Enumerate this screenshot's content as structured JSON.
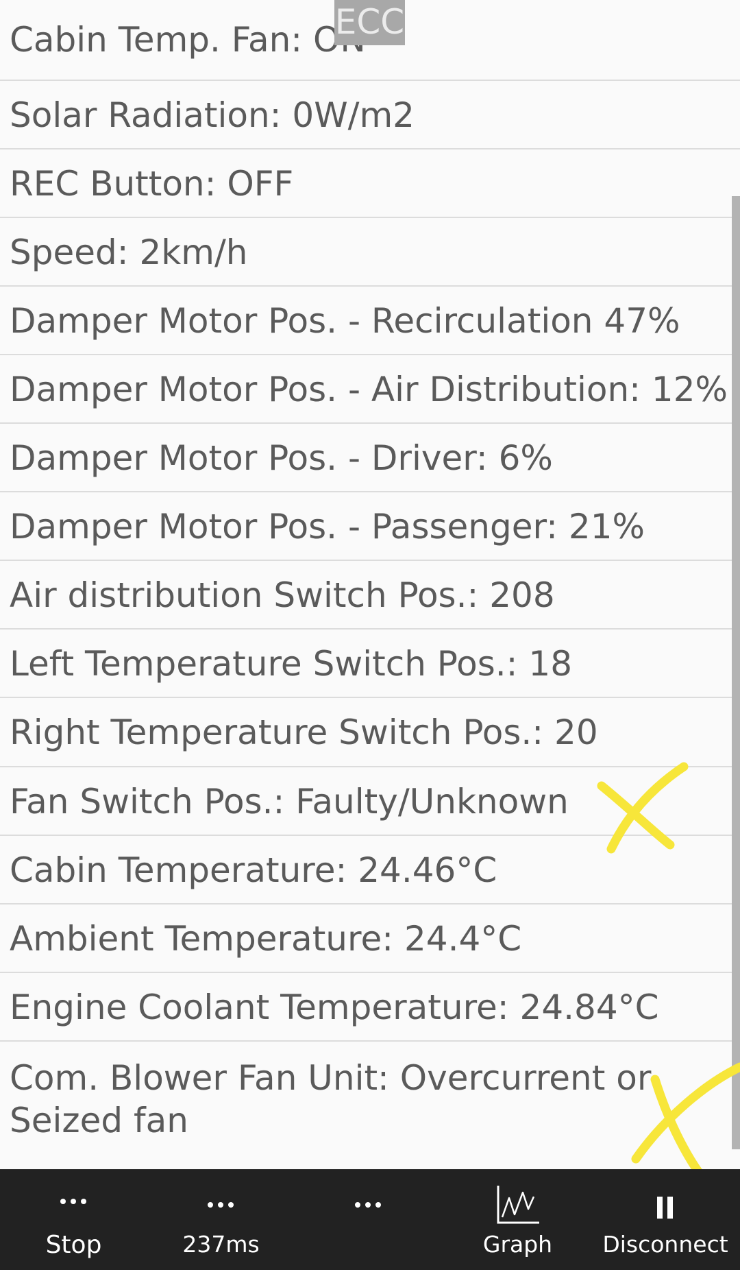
{
  "header": {
    "tab_label": "ECC"
  },
  "rows": [
    "Cabin Temp. Fan: ON",
    "Solar Radiation: 0W/m2",
    "REC Button: OFF",
    "Speed: 2km/h",
    "Damper Motor Pos. - Recirculation 47%",
    "Damper Motor Pos. - Air Distribution: 12%",
    "Damper Motor Pos. - Driver: 6%",
    "Damper Motor Pos. - Passenger: 21%",
    "Air distribution Switch Pos.: 208",
    "Left Temperature Switch Pos.: 18",
    "Right Temperature Switch Pos.: 20",
    "Fan Switch Pos.: Faulty/Unknown",
    "Cabin Temperature: 24.46°C",
    "Ambient Temperature: 24.4°C",
    "Engine Coolant Temperature: 24.84°C",
    "Com. Blower Fan Unit: Overcurrent or Seized fan"
  ],
  "toolbar": {
    "stop_label": "Stop",
    "latency_label": "237ms",
    "graph_label": "Graph",
    "disconnect_label": "Disconnect"
  },
  "colors": {
    "annotation": "#f7e63a",
    "navbar": "#222222",
    "text": "#5a5a5a"
  }
}
